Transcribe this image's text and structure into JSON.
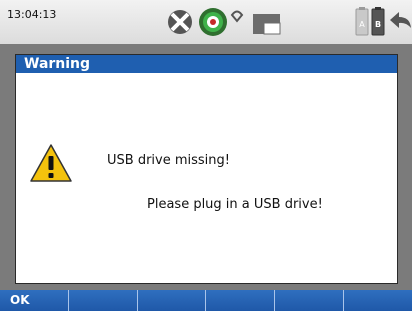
{
  "status": {
    "time": "13:04:13",
    "icons": [
      "close-circle-icon",
      "target-icon",
      "wifi-icon",
      "window-icon",
      "battery-a-icon",
      "battery-b-icon",
      "back-arrow-icon"
    ],
    "battery_labels": [
      "A",
      "B"
    ]
  },
  "dialog": {
    "title": "Warning",
    "icon": "warning-icon",
    "message_line1": "USB drive missing!",
    "message_line2": "Please plug in a USB drive!"
  },
  "softkeys": [
    "OK",
    "",
    "",
    "",
    "",
    ""
  ]
}
